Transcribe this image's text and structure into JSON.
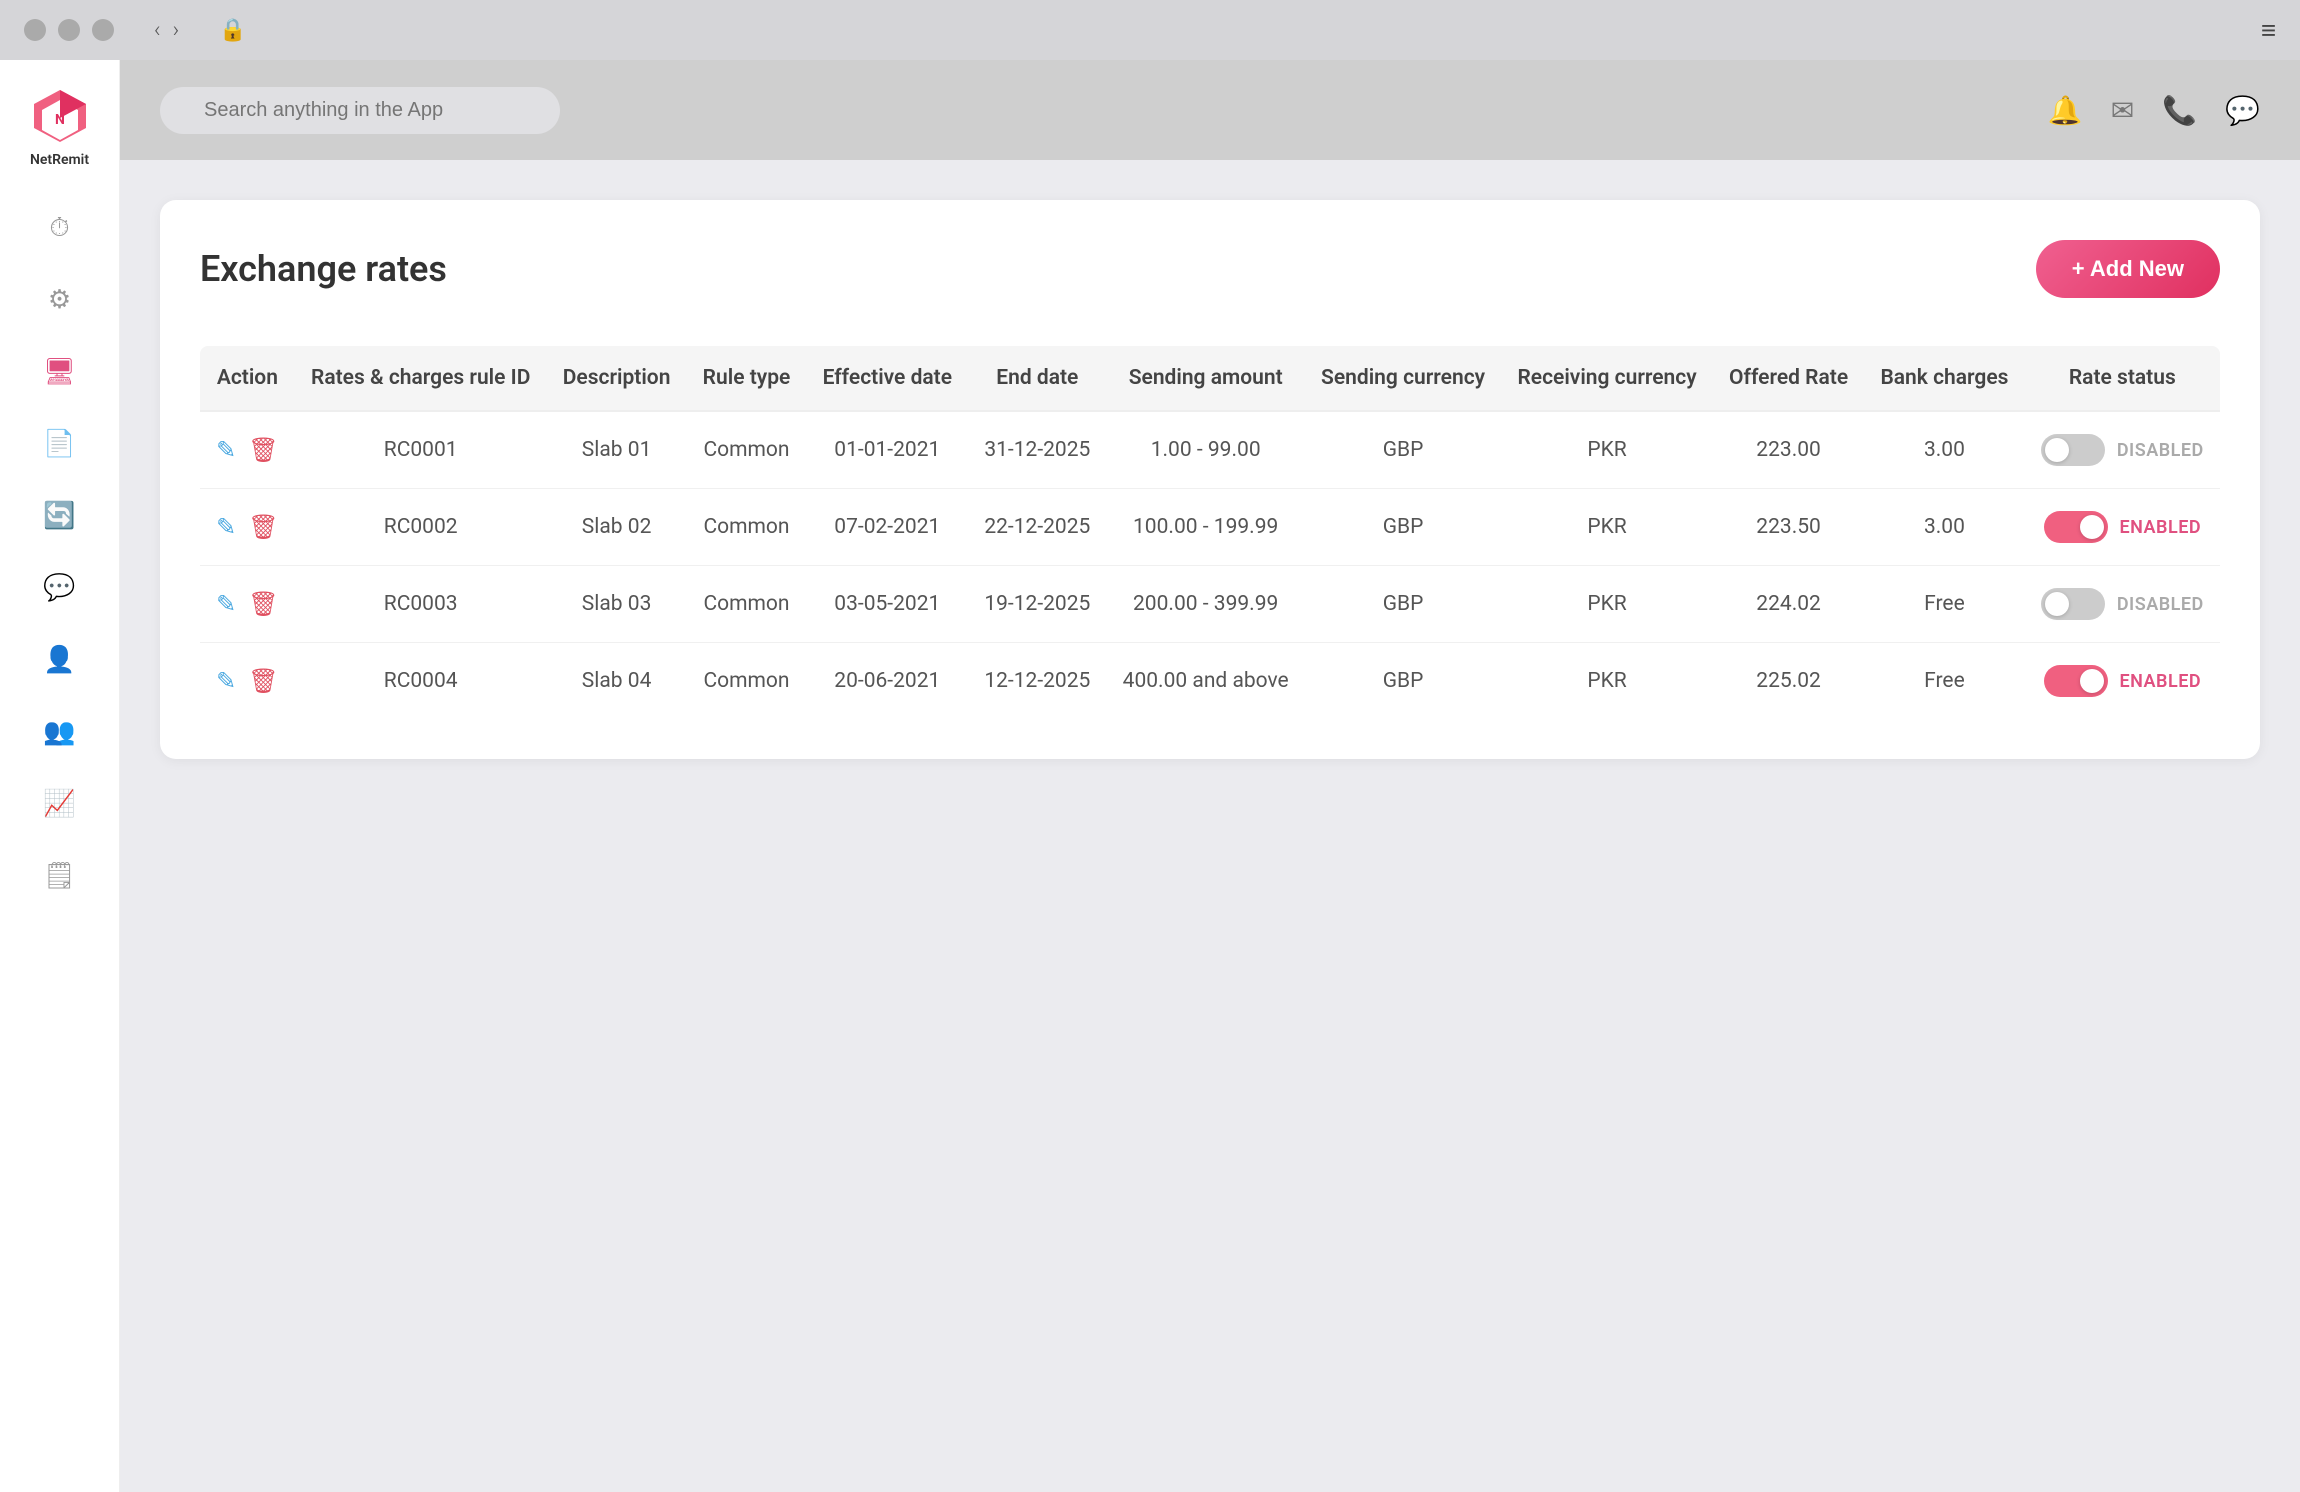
{
  "window": {
    "title": "NetRemit",
    "search_placeholder": "Search anything in the App"
  },
  "sidebar": {
    "logo_text": "NetRemit",
    "items": [
      {
        "id": "dashboard",
        "icon": "⏱",
        "label": "Dashboard",
        "active": false
      },
      {
        "id": "settings",
        "icon": "⚙",
        "label": "Settings",
        "active": false
      },
      {
        "id": "exchange",
        "icon": "🖥",
        "label": "Exchange",
        "active": true
      },
      {
        "id": "documents",
        "icon": "📄",
        "label": "Documents",
        "active": false
      },
      {
        "id": "sync",
        "icon": "🔄",
        "label": "Sync",
        "active": false
      },
      {
        "id": "messages",
        "icon": "💬",
        "label": "Messages",
        "active": false
      },
      {
        "id": "users",
        "icon": "👤",
        "label": "Users",
        "active": false
      },
      {
        "id": "team",
        "icon": "👥",
        "label": "Team",
        "active": false
      },
      {
        "id": "analytics",
        "icon": "📈",
        "label": "Analytics",
        "active": false
      },
      {
        "id": "reports",
        "icon": "🗒",
        "label": "Reports",
        "active": false
      }
    ]
  },
  "header": {
    "icons": [
      "🔔",
      "✉",
      "📞",
      "💬"
    ]
  },
  "page": {
    "title": "Exchange rates",
    "add_button_label": "+ Add New"
  },
  "table": {
    "columns": [
      "Action",
      "Rates & charges rule ID",
      "Description",
      "Rule type",
      "Effective date",
      "End date",
      "Sending amount",
      "Sending currency",
      "Receiving currency",
      "Offered Rate",
      "Bank charges",
      "Rate status"
    ],
    "rows": [
      {
        "id": "RC0001",
        "description": "Slab 01",
        "rule_type": "Common",
        "effective_date": "01-01-2021",
        "end_date": "31-12-2025",
        "sending_amount": "1.00 - 99.00",
        "sending_currency": "GBP",
        "receiving_currency": "PKR",
        "offered_rate": "223.00",
        "bank_charges": "3.00",
        "rate_status": "DISABLED",
        "enabled": false
      },
      {
        "id": "RC0002",
        "description": "Slab 02",
        "rule_type": "Common",
        "effective_date": "07-02-2021",
        "end_date": "22-12-2025",
        "sending_amount": "100.00 - 199.99",
        "sending_currency": "GBP",
        "receiving_currency": "PKR",
        "offered_rate": "223.50",
        "bank_charges": "3.00",
        "rate_status": "ENABLED",
        "enabled": true
      },
      {
        "id": "RC0003",
        "description": "Slab 03",
        "rule_type": "Common",
        "effective_date": "03-05-2021",
        "end_date": "19-12-2025",
        "sending_amount": "200.00 - 399.99",
        "sending_currency": "GBP",
        "receiving_currency": "PKR",
        "offered_rate": "224.02",
        "bank_charges": "Free",
        "rate_status": "DISABLED",
        "enabled": false
      },
      {
        "id": "RC0004",
        "description": "Slab 04",
        "rule_type": "Common",
        "effective_date": "20-06-2021",
        "end_date": "12-12-2025",
        "sending_amount": "400.00 and above",
        "sending_currency": "GBP",
        "receiving_currency": "PKR",
        "offered_rate": "225.02",
        "bank_charges": "Free",
        "rate_status": "ENABLED",
        "enabled": true
      }
    ]
  }
}
